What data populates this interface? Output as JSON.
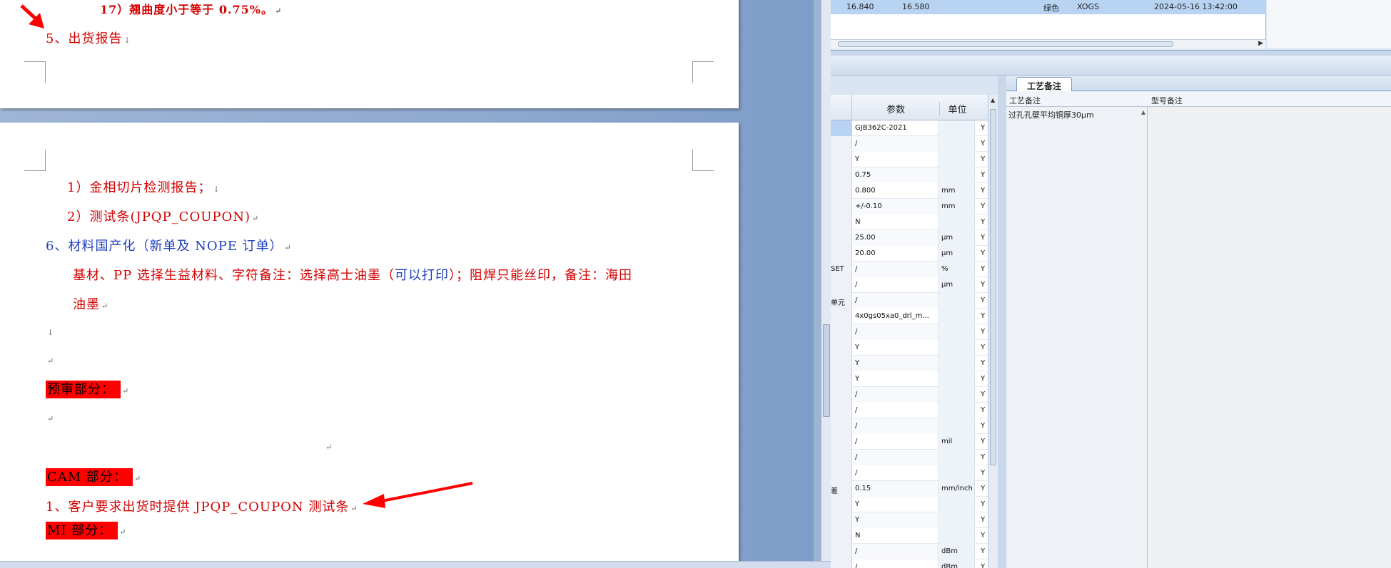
{
  "word": {
    "page1": {
      "item17": "17）翘曲度小于等于 0.75%。",
      "section5": "5、出货报告"
    },
    "page2": {
      "sub1": "1）金相切片检测报告；",
      "sub2": "2）测试条(JPQP_COUPON)",
      "section6": "6、材料国产化（新单及 NOPE 订单）",
      "material_a": "基材、PP 选择生益材料、字符备注：选择高士油墨（",
      "material_b": "可以打印",
      "material_c": "）；阻焊只能丝印",
      "material_d": "，备注：海田",
      "material_line2": "油墨",
      "pre_review": "预审部分：",
      "cam": "CAM 部分：",
      "cam_item1": "1、客户要求出货时提供 JPQP_COUPON 测试条",
      "mi": "MI 部分："
    },
    "para_mark": "↵",
    "para_mark_down": "↓"
  },
  "app": {
    "top_row": {
      "val1": "16.840",
      "val2": "16.580",
      "color": "绿色",
      "code": "XOGS",
      "datetime": "2024-05-16 13:42:00"
    },
    "params": {
      "header_param": "参数",
      "header_unit": "单位",
      "rows": [
        {
          "k": "",
          "v": "GJB362C-2021",
          "u": "",
          "y": "Y"
        },
        {
          "k": "",
          "v": "/",
          "u": "",
          "y": "Y"
        },
        {
          "k": "",
          "v": "Y",
          "u": "",
          "y": "Y"
        },
        {
          "k": "",
          "v": "0.75",
          "u": "",
          "y": "Y"
        },
        {
          "k": "",
          "v": "0.800",
          "u": "mm",
          "y": "Y"
        },
        {
          "k": "",
          "v": "+/-0.10",
          "u": "mm",
          "y": "Y"
        },
        {
          "k": "",
          "v": "N",
          "u": "",
          "y": "Y"
        },
        {
          "k": "",
          "v": "25.00",
          "u": "μm",
          "y": "Y"
        },
        {
          "k": "",
          "v": "20.00",
          "u": "μm",
          "y": "Y"
        },
        {
          "k": "SET",
          "v": "/",
          "u": "%",
          "y": "Y"
        },
        {
          "k": "",
          "v": "/",
          "u": "μm",
          "y": "Y"
        },
        {
          "k": "单元",
          "v": "/",
          "u": "",
          "y": "Y"
        },
        {
          "k": "",
          "v": "4x0gs05xa0_drl_m...",
          "u": "",
          "y": "Y"
        },
        {
          "k": "",
          "v": "/",
          "u": "",
          "y": "Y"
        },
        {
          "k": "",
          "v": "Y",
          "u": "",
          "y": "Y"
        },
        {
          "k": "",
          "v": "Y",
          "u": "",
          "y": "Y"
        },
        {
          "k": "",
          "v": "Y",
          "u": "",
          "y": "Y"
        },
        {
          "k": "",
          "v": "/",
          "u": "",
          "y": "Y"
        },
        {
          "k": "",
          "v": "/",
          "u": "",
          "y": "Y"
        },
        {
          "k": "",
          "v": "/",
          "u": "",
          "y": "Y"
        },
        {
          "k": "",
          "v": "/",
          "u": "mil",
          "y": "Y"
        },
        {
          "k": "",
          "v": "/",
          "u": "",
          "y": "Y"
        },
        {
          "k": "",
          "v": "/",
          "u": "",
          "y": "Y"
        },
        {
          "k": "差",
          "v": "0.15",
          "u": "mm/inch",
          "y": "Y"
        },
        {
          "k": "",
          "v": "Y",
          "u": "",
          "y": "Y"
        },
        {
          "k": "",
          "v": "Y",
          "u": "",
          "y": "Y"
        },
        {
          "k": "",
          "v": "N",
          "u": "",
          "y": "Y"
        },
        {
          "k": "",
          "v": "/",
          "u": "dBm",
          "y": "Y"
        },
        {
          "k": "",
          "v": "/",
          "u": "dBm",
          "y": "Y"
        }
      ]
    },
    "notes": {
      "tab_label": "工艺备注",
      "col1_header": "工艺备注",
      "col2_header": "型号备注",
      "col1_text": "过孔孔壁平均铜厚30μm"
    }
  },
  "colors": {
    "annotation_red": "#ff0000",
    "doc_red_text": "#d40000",
    "doc_blue_text": "#1f3fbf",
    "selection_blue": "#b9d4f3"
  }
}
